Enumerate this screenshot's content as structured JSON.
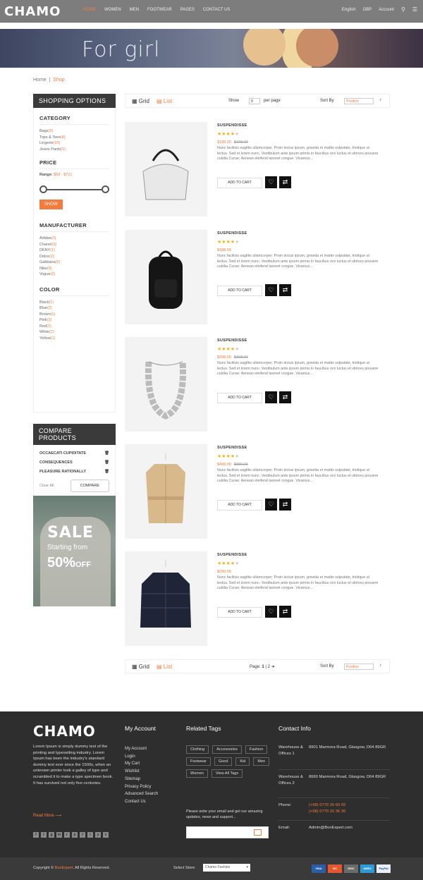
{
  "header": {
    "logo": "CHAMO",
    "nav": [
      "HOME",
      "WOMEN",
      "MEN",
      "FOOTWEAR",
      "PAGES",
      "CONTACT US"
    ],
    "right": [
      "English",
      "GBP",
      "Account"
    ]
  },
  "banner": {
    "title": "For girl"
  },
  "breadcrumb": {
    "home": "Home",
    "current": "Shop"
  },
  "sidebar": {
    "shopping_options": "SHOPPING OPTIONS",
    "category_title": "CATEGORY",
    "categories": [
      {
        "label": "Bags",
        "count": "(9)"
      },
      {
        "label": "Tops & Tees",
        "count": "(8)"
      },
      {
        "label": "Lingerie",
        "count": "(10)"
      },
      {
        "label": "Jeans Pants",
        "count": "(5)"
      }
    ],
    "price_title": "PRICE",
    "range_label": "Range:",
    "range_value": "$68 - $721",
    "show_button": "SHOW",
    "manufacturer_title": "MANUFACTURER",
    "manufacturers": [
      {
        "label": "Adidas",
        "count": "(3)"
      },
      {
        "label": "Chanel",
        "count": "(3)"
      },
      {
        "label": "DKNY",
        "count": "(1)"
      },
      {
        "label": "Dolce",
        "count": "(2)"
      },
      {
        "label": "Gabbana",
        "count": "(5)"
      },
      {
        "label": "Nike",
        "count": "(4)"
      },
      {
        "label": "Vogue",
        "count": "(2)"
      }
    ],
    "color_title": "COLOR",
    "colors": [
      {
        "label": "Black",
        "count": "(1)"
      },
      {
        "label": "Blue",
        "count": "(2)"
      },
      {
        "label": "Brown",
        "count": "(1)"
      },
      {
        "label": "Pink",
        "count": "(3)"
      },
      {
        "label": "Red",
        "count": "(2)"
      },
      {
        "label": "White",
        "count": "(2)"
      },
      {
        "label": "Yellow",
        "count": "(1)"
      }
    ],
    "compare_title": "COMPARE PRODUCTS",
    "compare_items": [
      "OCCAECATI CUPIDITATE",
      "CONSEQUENCES",
      "PLEASURE RATIONALLY"
    ],
    "clear_all": "Clear All",
    "compare_button": "COMPARE",
    "sale": {
      "line1": "SALE",
      "line2": "Starting from",
      "line3": "50%",
      "line3b": "OFF"
    }
  },
  "toolbar": {
    "grid": "Grid",
    "list": "List",
    "show_label": "Show",
    "show_value": "9",
    "per_page": "per page",
    "sort_by": "Sort By",
    "sort_value": "Position",
    "page_label": "Page:",
    "pages": [
      "1",
      "2"
    ]
  },
  "products": [
    {
      "name": "SUSPENDISSE",
      "rating": 4,
      "price": "$188.00",
      "old": "$198.00",
      "desc": "Nunc facilisis sagittis ullamcorper. Proin lectus ipsum, gravida et mattis vulputate, tristique ut lectus. Sed et lorem nunc. Vestibulum ante ipsum primis in faucibus orci luctus et ultrices posuere cubilia Curae; Aenean eleifend laoreet congue. Vivamus...",
      "image": "handbag-image"
    },
    {
      "name": "SUSPENDISSE",
      "rating": 4,
      "price": "$188.00",
      "old": "",
      "desc": "Nunc facilisis sagittis ullamcorper. Proin lectus ipsum, gravida et mattis vulputate, tristique ut lectus. Sed et lorem nunc. Vestibulum ante ipsum primis in faucibus orci luctus et ultrices posuere cubilia Curae; Aenean eleifend laoreet congue. Vivamus...",
      "image": "backpack-image"
    },
    {
      "name": "SUSPENDISSE",
      "rating": 4,
      "price": "$288.00",
      "old": "$308.00",
      "desc": "Nunc facilisis sagittis ullamcorper. Proin lectus ipsum, gravida et mattis vulputate, tristique ut lectus. Sed et lorem nunc. Vestibulum ante ipsum primis in faucibus orci luctus et ultrices posuere cubilia Curae; Aenean eleifend laoreet congue. Vivamus...",
      "image": "necklace-image"
    },
    {
      "name": "SUSPENDISSE",
      "rating": 4,
      "price": "$400.00",
      "old": "$880.00",
      "desc": "Nunc facilisis sagittis ullamcorper. Proin lectus ipsum, gravida et mattis vulputate, tristique ut lectus. Sed et lorem nunc. Vestibulum ante ipsum primis in faucibus orci luctus et ultrices posuere cubilia Curae; Aenean eleifend laoreet congue. Vivamus...",
      "image": "trench-coat-image"
    },
    {
      "name": "SUSPENDISSE",
      "rating": 4,
      "price": "$200.00",
      "old": "",
      "desc": "Nunc facilisis sagittis ullamcorper. Proin lectus ipsum, gravida et mattis vulputate, tristique ut lectus. Sed et lorem nunc. Vestibulum ante ipsum primis in faucibus orci luctus et ultrices posuere cubilia Curae; Aenean eleifend laoreet congue. Vivamus...",
      "image": "puffer-jacket-image"
    }
  ],
  "add_to_cart": "ADD TO CART",
  "footer": {
    "logo": "CHAMO",
    "about": "Lorem Ipsum is simply dummy text of the printing and typesetting industry. Lorem Ipsum has been the industry's standard dummy text ever since the 1500s, when an unknown printer took a galley of type and scrambled it to make a type specimen book. It has survived not only five centuries.",
    "read_more": "Read More",
    "account_title": "My Account",
    "account_links": [
      "My Account",
      "Login",
      "My Cart",
      "Wishlist",
      "Sitemap",
      "Privacy Policy",
      "Advanced Search",
      "Contact Us"
    ],
    "tags_title": "Related Tags",
    "tags": [
      "Clothing",
      "Accessories",
      "Fashion",
      "Footwear",
      "Good",
      "Kid",
      "Men",
      "Women",
      "View All Tags"
    ],
    "newsletter": "Please write your email and get our amazing updates, news and support...",
    "contact_title": "Contact Info",
    "w1_label": "Warehouse & Offices 1",
    "w1_addr": "8901 Marmora Road, Glasgow, D04 89GR",
    "w2_label": "Warehouse & Offices 2",
    "w2_addr": "8669 Marmora Road, Glasgow, D04 89GR",
    "phone_label": "Phone:",
    "phone1": "(+68) 0770 26 65 65",
    "phone2": "(+68) 0770 20 36 36",
    "email_label": "Email:",
    "email": "Admin@BooExpert.com"
  },
  "copyright": {
    "prefix": "Copyright ©",
    "brand": "BooExpert",
    "suffix": ". All Rights Reserved.",
    "store_label": "Select Store:",
    "store_value": "Chamo Fashion"
  },
  "payments": [
    "VISA",
    "MC",
    "DISC",
    "AMEX",
    "PayPal"
  ],
  "colors": {
    "accent": "#f47b3e",
    "dark": "#2e2e2e",
    "star": "#f2b01e"
  }
}
